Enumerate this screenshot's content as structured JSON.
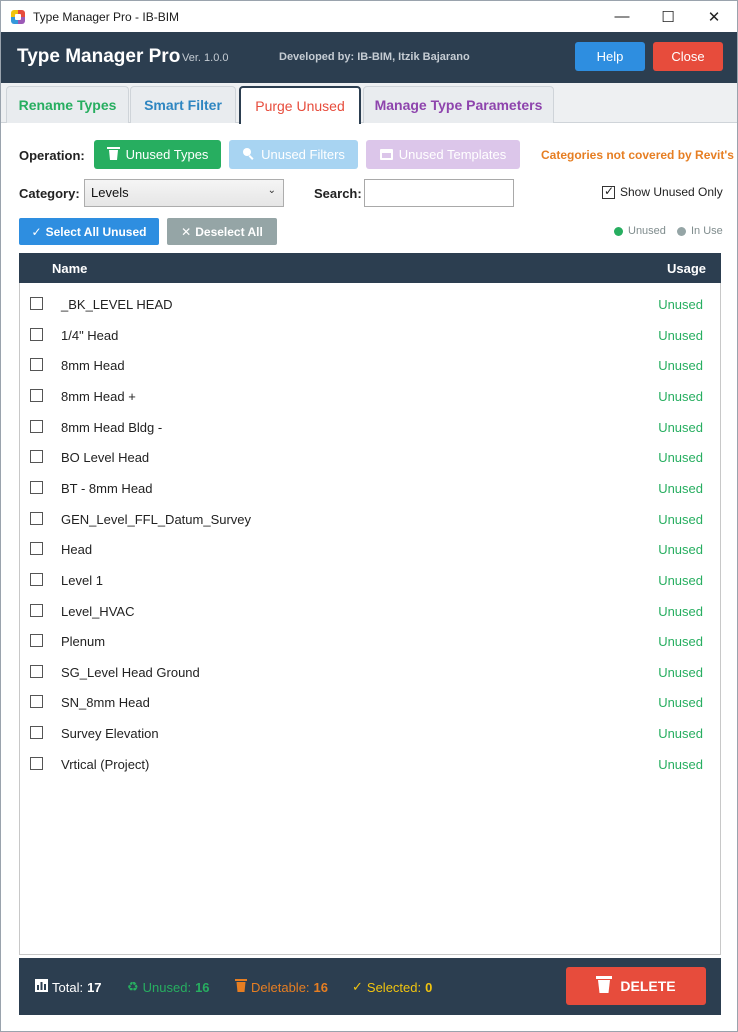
{
  "window": {
    "title": "Type Manager Pro - IB-BIM",
    "controls": {
      "minimize": "—",
      "maximize": "☐",
      "close": "✕"
    }
  },
  "header": {
    "app_name": "Type Manager Pro",
    "version": "Ver. 1.0.0",
    "developer": "Developed by: IB-BIM, Itzik Bajarano",
    "help_label": "Help",
    "close_label": "Close"
  },
  "tabs": [
    {
      "label": "Rename Types",
      "active": false
    },
    {
      "label": "Smart Filter",
      "active": false
    },
    {
      "label": "Purge Unused",
      "active": true
    },
    {
      "label": "Manage Type Parameters",
      "active": false
    }
  ],
  "operation": {
    "label": "Operation:",
    "buttons": [
      {
        "label": "Unused Types",
        "icon": "trash-icon"
      },
      {
        "label": "Unused Filters",
        "icon": "search-icon"
      },
      {
        "label": "Unused Templates",
        "icon": "calendar-icon"
      }
    ],
    "note": "Categories not covered by Revit's"
  },
  "category": {
    "label": "Category:",
    "selected": "Levels"
  },
  "search": {
    "label": "Search:",
    "value": "",
    "placeholder": ""
  },
  "show_unused_only": {
    "label": "Show Unused Only",
    "checked": true
  },
  "selection": {
    "select_all_label": "Select All Unused",
    "deselect_all_label": "Deselect All"
  },
  "legend": {
    "unused": "Unused",
    "in_use": "In Use"
  },
  "list": {
    "headers": {
      "name": "Name",
      "usage": "Usage"
    },
    "rows": [
      {
        "name": "_BK_LEVEL HEAD",
        "usage": "Unused"
      },
      {
        "name": "1/4\" Head",
        "usage": "Unused"
      },
      {
        "name": "8mm Head",
        "usage": "Unused"
      },
      {
        "name": "8mm Head +",
        "usage": "Unused"
      },
      {
        "name": "8mm Head Bldg -",
        "usage": "Unused"
      },
      {
        "name": "BO Level Head",
        "usage": "Unused"
      },
      {
        "name": "BT - 8mm Head",
        "usage": "Unused"
      },
      {
        "name": "GEN_Level_FFL_Datum_Survey",
        "usage": "Unused"
      },
      {
        "name": "Head",
        "usage": "Unused"
      },
      {
        "name": "Level 1",
        "usage": "Unused"
      },
      {
        "name": "Level_HVAC",
        "usage": "Unused"
      },
      {
        "name": "Plenum",
        "usage": "Unused"
      },
      {
        "name": "SG_Level Head Ground",
        "usage": "Unused"
      },
      {
        "name": "SN_8mm Head",
        "usage": "Unused"
      },
      {
        "name": "Survey Elevation",
        "usage": "Unused"
      },
      {
        "name": "Vrtical (Project)",
        "usage": "Unused"
      }
    ]
  },
  "footer": {
    "total_label": "Total:",
    "total_value": "17",
    "unused_label": "Unused:",
    "unused_value": "16",
    "deletable_label": "Deletable:",
    "deletable_value": "16",
    "selected_label": "Selected:",
    "selected_value": "0",
    "delete_label": "DELETE"
  },
  "colors": {
    "header_bg": "#2c3e50",
    "green": "#27ae60",
    "blue": "#2e8ee0",
    "red": "#e74c3c",
    "orange": "#e67e22",
    "yellow": "#f1c40f",
    "purple": "#8e44ad",
    "gray": "#95a5a6"
  }
}
